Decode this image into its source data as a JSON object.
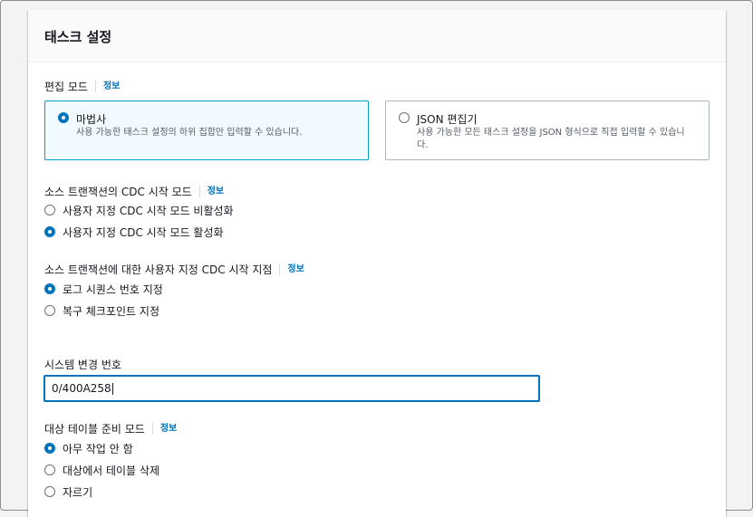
{
  "panel": {
    "title": "태스크 설정"
  },
  "info_label": "정보",
  "edit_mode": {
    "label": "편집 모드",
    "options": [
      {
        "title": "마법사",
        "desc": "사용 가능한 태스크 설정의 하위 집합만 입력할 수 있습니다.",
        "selected": true
      },
      {
        "title": "JSON 편집기",
        "desc": "사용 가능한 모든 태스크 설정을 JSON 형식으로 직접 입력할 수 있습니다.",
        "selected": false
      }
    ]
  },
  "cdc_start_mode": {
    "label": "소스 트랜잭션의 CDC 시작 모드",
    "options": [
      {
        "label": "사용자 지정 CDC 시작 모드 비활성화",
        "selected": false
      },
      {
        "label": "사용자 지정 CDC 시작 모드 활성화",
        "selected": true
      }
    ]
  },
  "cdc_start_point": {
    "label": "소스 트랜잭션에 대한 사용자 지정 CDC 시작 지점",
    "options": [
      {
        "label": "로그 시퀀스 번호 지정",
        "selected": true
      },
      {
        "label": "복구 체크포인트 지정",
        "selected": false
      }
    ]
  },
  "system_change_number": {
    "label": "시스템 변경 번호",
    "value": "0/400A258"
  },
  "target_table_prep": {
    "label": "대상 테이블 준비 모드",
    "options": [
      {
        "label": "아무 작업 안 함",
        "selected": true
      },
      {
        "label": "대상에서 테이블 삭제",
        "selected": false
      },
      {
        "label": "자르기",
        "selected": false
      }
    ]
  },
  "colors": {
    "accent": "#0073bb",
    "selected_tile_bg": "#f1faff",
    "selected_tile_border": "#00a1c9"
  }
}
